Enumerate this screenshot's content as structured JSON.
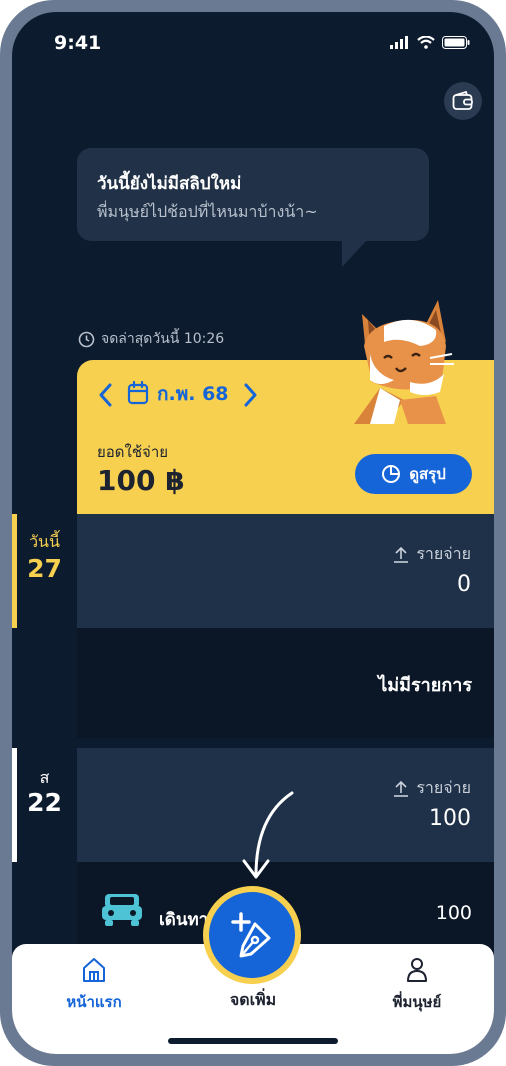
{
  "status_bar": {
    "time": "9:41"
  },
  "speech_bubble": {
    "title": "วันนี้ยังไม่มีสลิปใหม่",
    "subtitle": "พี่มนุษย์ไปช้อปที่ไหนมาบ้างน้า~"
  },
  "last_updated": "จดล่าสุดวันนี้ 10:26",
  "summary_card": {
    "month": "ก.พ. 68",
    "spend_label": "ยอดใช้จ่าย",
    "spend_value": "100 ฿",
    "summary_button": "ดูสรุป"
  },
  "days": [
    {
      "top_label": "วันนี้",
      "day": "27",
      "expense_label": "รายจ่าย",
      "expense_value": "0",
      "empty_text": "ไม่มีรายการ"
    },
    {
      "top_label": "ส",
      "day": "22",
      "expense_label": "รายจ่าย",
      "expense_value": "100"
    }
  ],
  "transaction": {
    "name": "เดินทา",
    "amount": "100"
  },
  "tabbar": {
    "home": "หน้าแรก",
    "add": "จดเพิ่ม",
    "profile": "พี่มนุษย์"
  },
  "colors": {
    "background": "#0d1b2e",
    "accent": "#1565d8",
    "highlight": "#f7d04f"
  }
}
